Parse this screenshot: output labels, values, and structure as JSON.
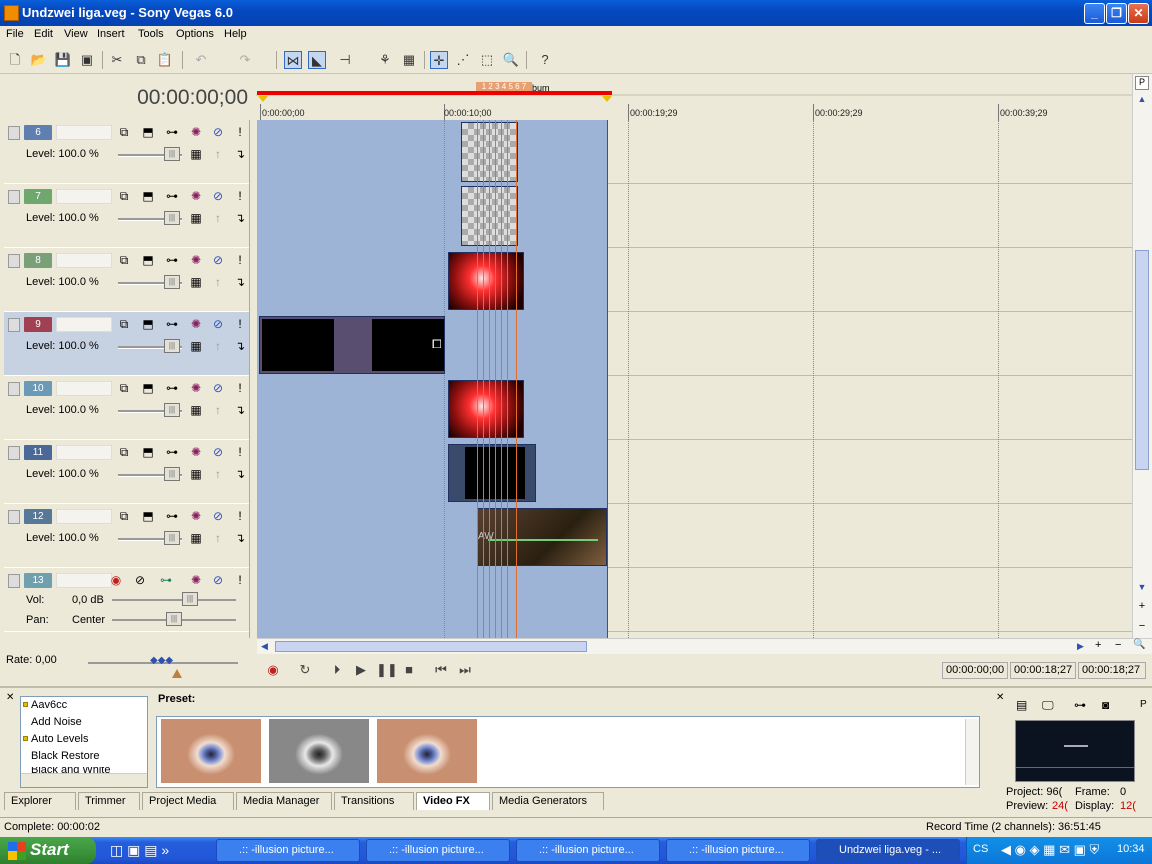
{
  "window": {
    "title": "Undzwei liga.veg - Sony Vegas 6.0",
    "buttons": {
      "minimize": "_",
      "maximize": "❐",
      "close": "✕"
    }
  },
  "menu": [
    "File",
    "Edit",
    "View",
    "Insert",
    "Tools",
    "Options",
    "Help"
  ],
  "timeline": {
    "cursor_time": "00:00:00;00",
    "ruler_labels": [
      "0:00:00;00",
      "00:00:10;00",
      "00:00:19;29",
      "00:00:29;29",
      "00:00:39;29"
    ],
    "region_label": "bum",
    "marker_numbers": "1 2 3 4 5 6 7"
  },
  "tracks": [
    {
      "number": "6",
      "color": "#5f7fb0",
      "type": "video",
      "label": "Level: 100.0 %"
    },
    {
      "number": "7",
      "color": "#6ea86e",
      "type": "video",
      "label": "Level: 100.0 %"
    },
    {
      "number": "8",
      "color": "#7aa07a",
      "type": "video",
      "label": "Level: 100.0 %"
    },
    {
      "number": "9",
      "color": "#a04050",
      "type": "video",
      "label": "Level: 100.0 %",
      "selected": true
    },
    {
      "number": "10",
      "color": "#6a9ab8",
      "type": "video",
      "label": "Level: 100.0 %"
    },
    {
      "number": "11",
      "color": "#4a6898",
      "type": "video",
      "label": "Level: 100.0 %"
    },
    {
      "number": "12",
      "color": "#587898",
      "type": "video",
      "label": "Level: 100.0 %"
    },
    {
      "number": "13",
      "color": "#70a0b0",
      "type": "audio",
      "vol_label": "Vol:",
      "vol_value": "0,0 dB",
      "pan_label": "Pan:",
      "pan_value": "Center"
    }
  ],
  "transport": {
    "rate": "Rate: 0,00",
    "time_cursor": "00:00:00;00",
    "time_end": "00:00:18;27",
    "time_length": "00:00:18;27"
  },
  "video_fx": {
    "list": [
      "Aav6cc",
      "Add Noise",
      "Auto Levels",
      "Black Restore",
      "Black and White"
    ],
    "preset_label": "Preset:"
  },
  "dock_tabs": [
    "Explorer",
    "Trimmer",
    "Project Media",
    "Media Manager",
    "Transitions",
    "Video FX",
    "Media Generators"
  ],
  "active_dock_tab": "Video FX",
  "preview": {
    "project": "Project:  96(",
    "frame": "Frame:",
    "frame_value": "0",
    "preview": "Preview:",
    "preview_value": "24(",
    "display": "Display:",
    "display_value": "12("
  },
  "status": {
    "left": "Complete: 00:00:02",
    "right": "Record Time (2 channels): 36:51:45"
  },
  "taskbar": {
    "start": "Start",
    "tasks": [
      ".:: -illusion picture...",
      ".:: -illusion picture...",
      ".:: -illusion picture...",
      ".:: -illusion picture...",
      "Undzwei liga.veg - ..."
    ],
    "lang": "CS",
    "clock": "10:34"
  }
}
